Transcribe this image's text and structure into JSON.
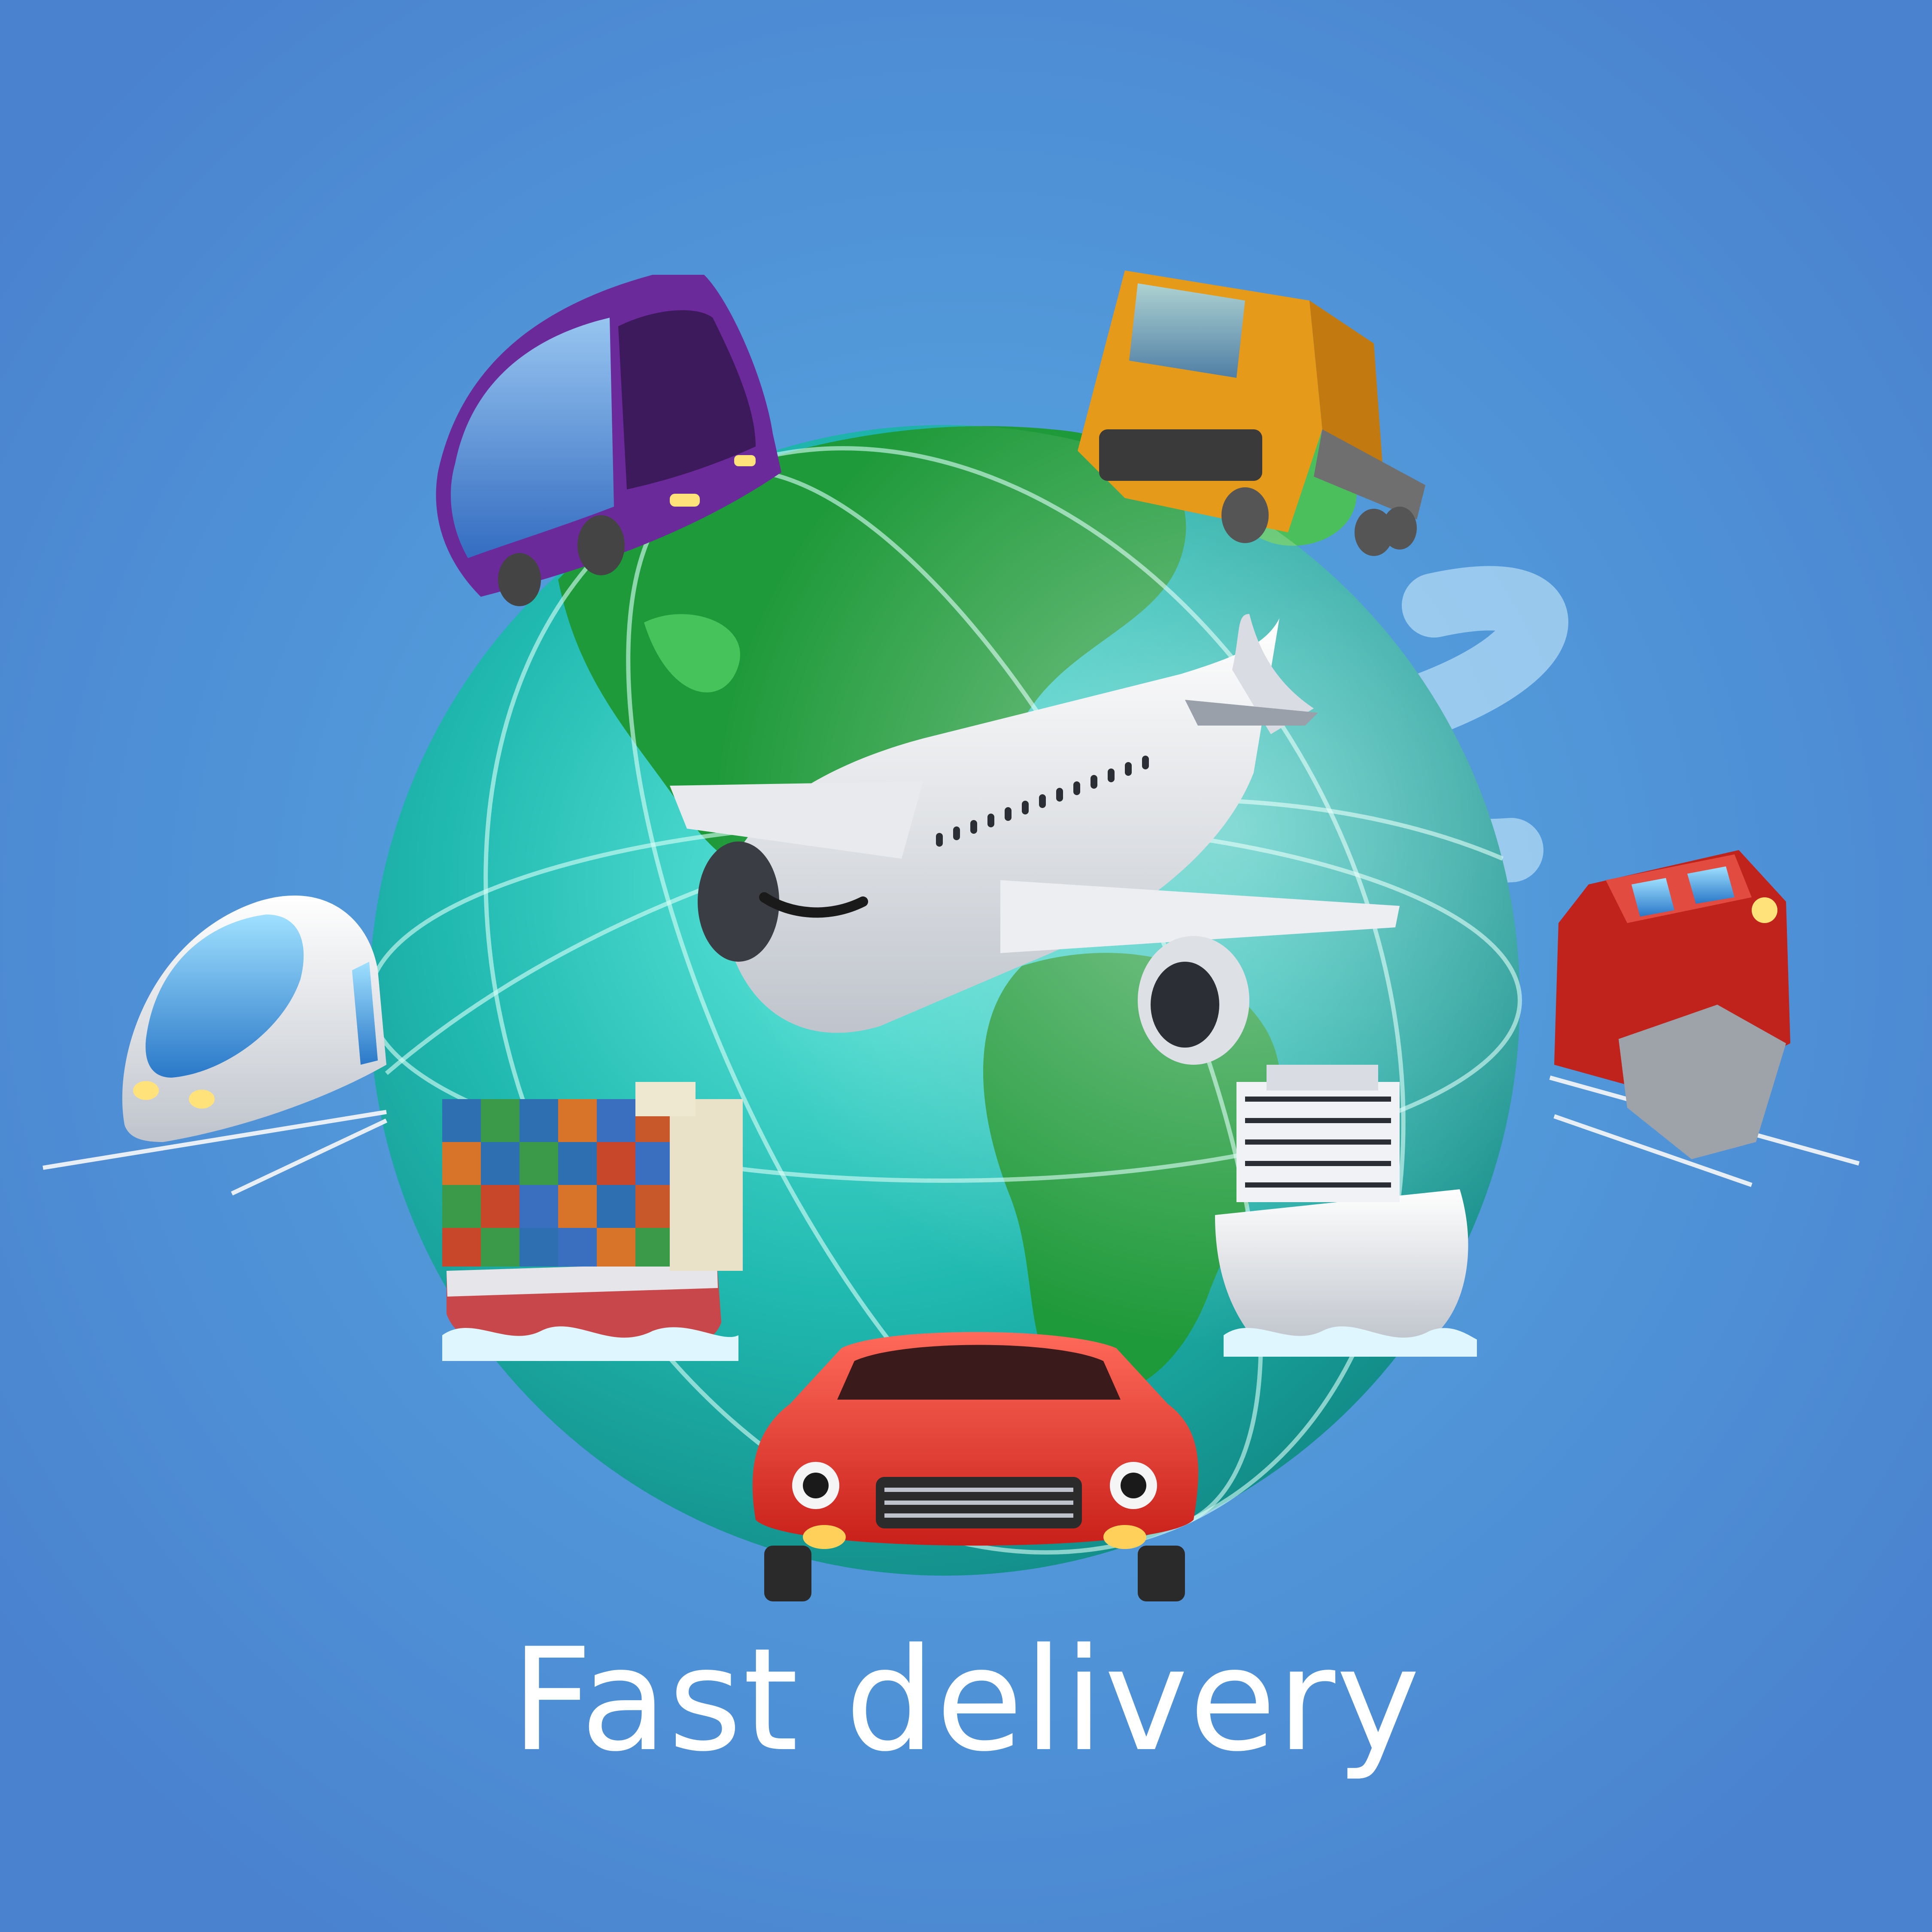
{
  "headline": "Fast delivery",
  "colors": {
    "background": "#4a86d0",
    "background_glow": "#55a6e0",
    "ocean": "#2ec8c0",
    "land": "#1f9a3a",
    "headline": "#ffffff"
  },
  "icons": [
    "globe-icon",
    "airplane-icon",
    "bus-icon",
    "truck-icon",
    "bullet-train-icon",
    "locomotive-icon",
    "container-ship-icon",
    "cruise-ship-icon",
    "car-icon"
  ]
}
